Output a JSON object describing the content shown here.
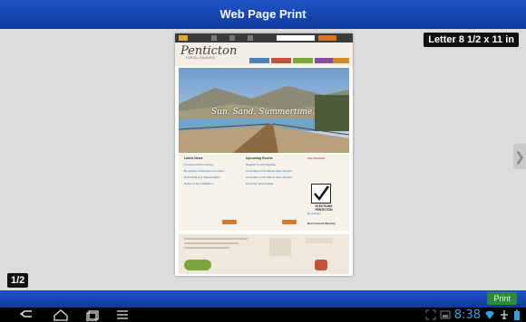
{
  "window": {
    "title": "Web Page Print"
  },
  "paper_size": "Letter 8 1/2 x 11 in",
  "page_indicator": "1/2",
  "print_label": "Print",
  "preview": {
    "logo": "Penticton",
    "logo_sub": "FOR ALL SEASONS",
    "hero_text": "Sun. Sand. Summertime.",
    "col1_title": "Latest News",
    "col1_items": [
      "Penticton Online Survey",
      "By-election Information for voters",
      "2011 Parking & Transportation",
      "Notice of Tax Installation"
    ],
    "col2_title": "Upcoming Events",
    "col2_items": [
      "Regular Council Meeting",
      "Committee of the Whole Open Session",
      "Committee of the Whole Open Session",
      "Fireworks and Festival"
    ],
    "side_title": "City Spotlight",
    "elections_label": "ELECTIONS PENTICTON",
    "side_link": "By-election",
    "side_meeting": "Next Council Meeting"
  },
  "status": {
    "time": "8:38"
  },
  "icons": {
    "back": "back-icon",
    "home": "home-icon",
    "recent": "recent-apps-icon",
    "menu": "menu-icon",
    "expand": "expand-icon",
    "screenshot": "screenshot-icon",
    "wifi": "wifi-icon",
    "airplane": "airplane-icon",
    "battery": "battery-icon",
    "next": "next-page-icon"
  },
  "colors": {
    "title_bar": "#1e54c8",
    "print_button": "#2d8a3a",
    "status_accent": "#2fa7d8"
  }
}
